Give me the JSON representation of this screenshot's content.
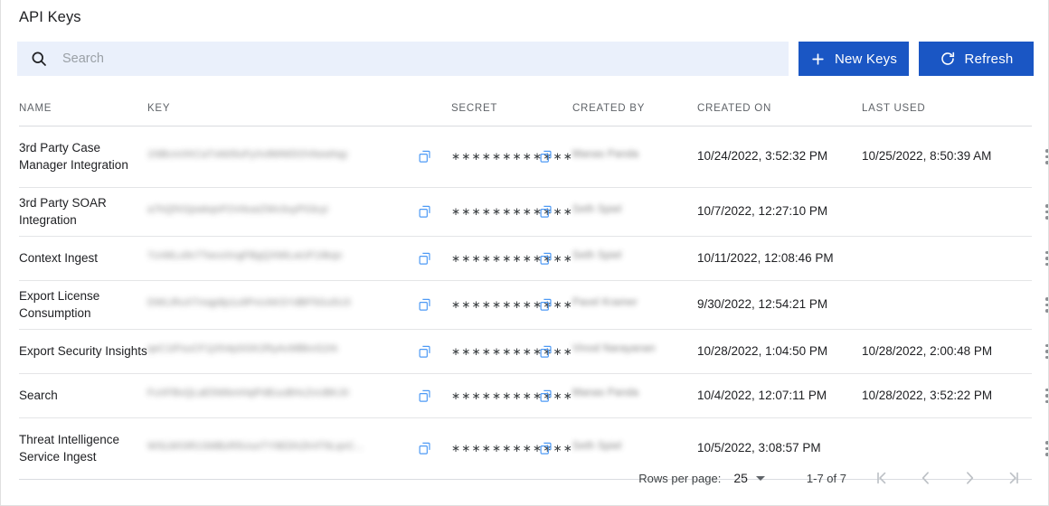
{
  "page": {
    "title": "API Keys"
  },
  "toolbar": {
    "search": {
      "placeholder": "Search",
      "value": "",
      "icon": "search-icon"
    },
    "new_keys": {
      "label": "New Keys",
      "icon": "plus-icon"
    },
    "refresh": {
      "label": "Refresh",
      "icon": "refresh-icon"
    },
    "accent_color": "#1a56c4",
    "search_bg": "#eaf0fb"
  },
  "table": {
    "columns": [
      "NAME",
      "KEY",
      "SECRET",
      "CREATED BY",
      "CREATED ON",
      "LAST USED"
    ],
    "secret_mask": "∗∗∗∗∗∗∗∗∗∗∗∗",
    "copy_icon": "copy-icon",
    "menu_icon": "kebab-menu-icon",
    "rows": [
      {
        "name": "3rd Party Case Manager Integration",
        "key": "1NBcmXKCaTvkb5luFyXv8MWDOVkewhqy",
        "secret": "∗∗∗∗∗∗∗∗∗∗∗∗",
        "created_by": "Manas Panda",
        "created_on": "10/24/2022, 3:52:32 PM",
        "last_used": "10/25/2022, 8:50:39 AM"
      },
      {
        "name": "3rd Party SOAR Integration",
        "key": "a7hQfXGjoekqnP2VrkueZWv3uyP03cyi",
        "secret": "∗∗∗∗∗∗∗∗∗∗∗∗",
        "created_by": "Seth Spiel",
        "created_on": "10/7/2022, 12:27:10 PM",
        "last_used": ""
      },
      {
        "name": "Context Ingest",
        "key": "7cnMLu9n7TwcoXngFBgQXMiLwUF19kqn",
        "secret": "∗∗∗∗∗∗∗∗∗∗∗∗",
        "created_by": "Seth Spiel",
        "created_on": "10/11/2022, 12:08:46 PM",
        "last_used": ""
      },
      {
        "name": "Export License Consumption",
        "key": "DWLiRuXTmqp8p1u9PvUAKSYdBF5Gu5U3",
        "secret": "∗∗∗∗∗∗∗∗∗∗∗∗",
        "created_by": "Pavel Kramer",
        "created_on": "9/30/2022, 12:54:21 PM",
        "last_used": ""
      },
      {
        "name": "Export Security Insights",
        "key": "qeC1tFsuCF1jXh4pSGK2RyAcMBknG2rk",
        "secret": "∗∗∗∗∗∗∗∗∗∗∗∗",
        "created_by": "Vinod Narayanan",
        "created_on": "10/28/2022, 1:04:50 PM",
        "last_used": "10/28/2022, 2:00:48 PM"
      },
      {
        "name": "Search",
        "key": "FuXFBvQLaE5WbmHqiPdEuuBHcZvUBKJ0",
        "secret": "∗∗∗∗∗∗∗∗∗∗∗∗",
        "created_by": "Manas Panda",
        "created_on": "10/4/2022, 12:07:11 PM",
        "last_used": "10/28/2022, 3:52:22 PM"
      },
      {
        "name": "Threat Intelligence Service Ingest",
        "key": "WSLWOiR1SMBzR5UuoTY9EDhZK4T9LqnC...",
        "secret": "∗∗∗∗∗∗∗∗∗∗∗∗",
        "created_by": "Seth Spiel",
        "created_on": "10/5/2022, 3:08:57 PM",
        "last_used": ""
      }
    ]
  },
  "footer": {
    "rows_per_page_label": "Rows per page:",
    "rows_per_page_value": "25",
    "range": "1-7 of 7",
    "first_page_icon": "first-page-icon",
    "prev_page_icon": "previous-page-icon",
    "next_page_icon": "next-page-icon",
    "last_page_icon": "last-page-icon"
  }
}
